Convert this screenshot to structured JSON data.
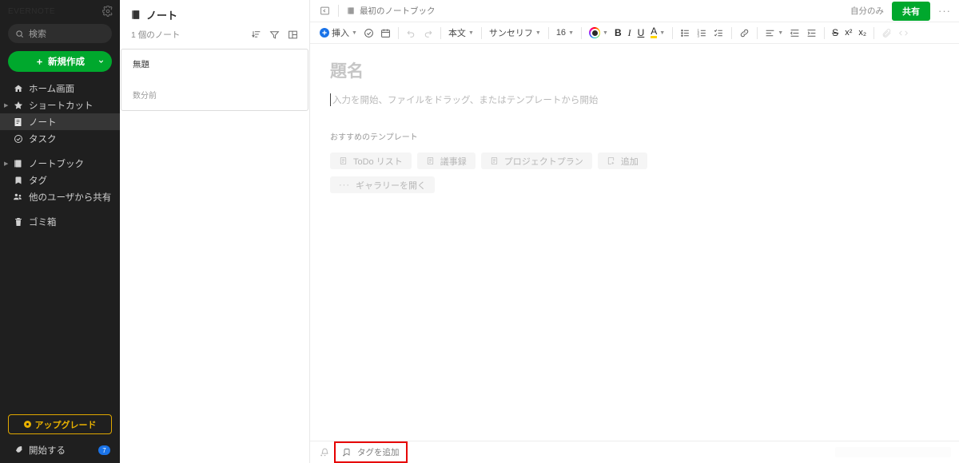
{
  "sidebar": {
    "logo_text": "EVERNOTE",
    "gear_icon": "gear-icon",
    "search": {
      "placeholder": "検索",
      "icon": "search-icon"
    },
    "new_button": {
      "label": "新規作成",
      "plus_icon": "plus-icon",
      "chevron_icon": "chevron-down-icon",
      "color": "#00a82d"
    },
    "items": [
      {
        "label": "ホーム画面",
        "icon": "home-icon",
        "expandable": false,
        "selected": false
      },
      {
        "label": "ショートカット",
        "icon": "star-icon",
        "expandable": true,
        "selected": false
      },
      {
        "label": "ノート",
        "icon": "note-icon",
        "expandable": false,
        "selected": true
      },
      {
        "label": "タスク",
        "icon": "task-check-icon",
        "expandable": false,
        "selected": false
      },
      {
        "label": "ノートブック",
        "icon": "notebook-icon",
        "expandable": true,
        "selected": false
      },
      {
        "label": "タグ",
        "icon": "tag-icon",
        "expandable": false,
        "selected": false
      },
      {
        "label": "他のユーザから共有",
        "icon": "shared-users-icon",
        "expandable": false,
        "selected": false
      },
      {
        "label": "ゴミ箱",
        "icon": "trash-icon",
        "expandable": false,
        "selected": false
      }
    ],
    "upgrade": {
      "label": "アップグレード",
      "icon": "upgrade-dot-icon",
      "border_color": "#e0a800",
      "text_color": "#e8b100"
    },
    "get_started": {
      "label": "開始する",
      "icon": "rocket-icon",
      "badge": "7",
      "badge_color": "#1a73e8"
    }
  },
  "notelist": {
    "title": "ノート",
    "title_icon": "note-icon",
    "count_label": "1 個のノート",
    "actions": [
      {
        "name": "sort-icon",
        "label": "並べ替え"
      },
      {
        "name": "filter-icon",
        "label": "フィルタ"
      },
      {
        "name": "view-layout-icon",
        "label": "表示"
      }
    ],
    "notes": [
      {
        "title": "無題",
        "time": "数分前"
      }
    ]
  },
  "editor": {
    "topbar": {
      "expand_icon": "expand-panel-icon",
      "notebook_icon": "notebook-icon",
      "notebook_name": "最初のノートブック",
      "visibility": "自分のみ",
      "share_label": "共有",
      "share_color": "#00a82d",
      "more_label": "···"
    },
    "toolbar": {
      "insert_label": "挿入",
      "insert_icon": "plus-circle-icon",
      "task_icon": "task-check-icon",
      "calendar_icon": "calendar-icon",
      "undo_icon": "undo-icon",
      "redo_icon": "redo-icon",
      "paragraph_style": "本文",
      "font_family": "サンセリフ",
      "font_size": "16",
      "color_icon": "text-color-ring-icon",
      "bold_label": "B",
      "italic_label": "I",
      "underline_label": "U",
      "highlight_label": "A",
      "bulleted_list_icon": "bulleted-list-icon",
      "numbered_list_icon": "numbered-list-icon",
      "checklist_icon": "checklist-icon",
      "link_icon": "link-icon",
      "align_icon": "align-left-icon",
      "outdent_icon": "outdent-icon",
      "indent_icon": "indent-icon",
      "strikethrough_label": "S",
      "superscript_label": "x²",
      "subscript_label": "x₂",
      "attach_icon": "attachment-icon",
      "code_icon": "code-icon"
    },
    "note": {
      "title_placeholder": "題名",
      "body_placeholder": "入力を開始、ファイルをドラッグ、またはテンプレートから開始"
    },
    "templates": {
      "label": "おすすめのテンプレート",
      "row1": [
        {
          "label": "ToDo リスト",
          "icon": "template-doc-icon"
        },
        {
          "label": "議事録",
          "icon": "template-doc-icon"
        },
        {
          "label": "プロジェクトプラン",
          "icon": "template-doc-icon"
        },
        {
          "label": "追加",
          "icon": "template-add-icon"
        }
      ],
      "row2": [
        {
          "label": "ギャラリーを開く",
          "icon": "ellipsis-icon"
        }
      ]
    },
    "bottombar": {
      "reminder_icon": "bell-reminder-icon",
      "tag_icon": "tag-add-icon",
      "tag_label": "タグを追加",
      "highlight_color": "#e60000"
    }
  }
}
